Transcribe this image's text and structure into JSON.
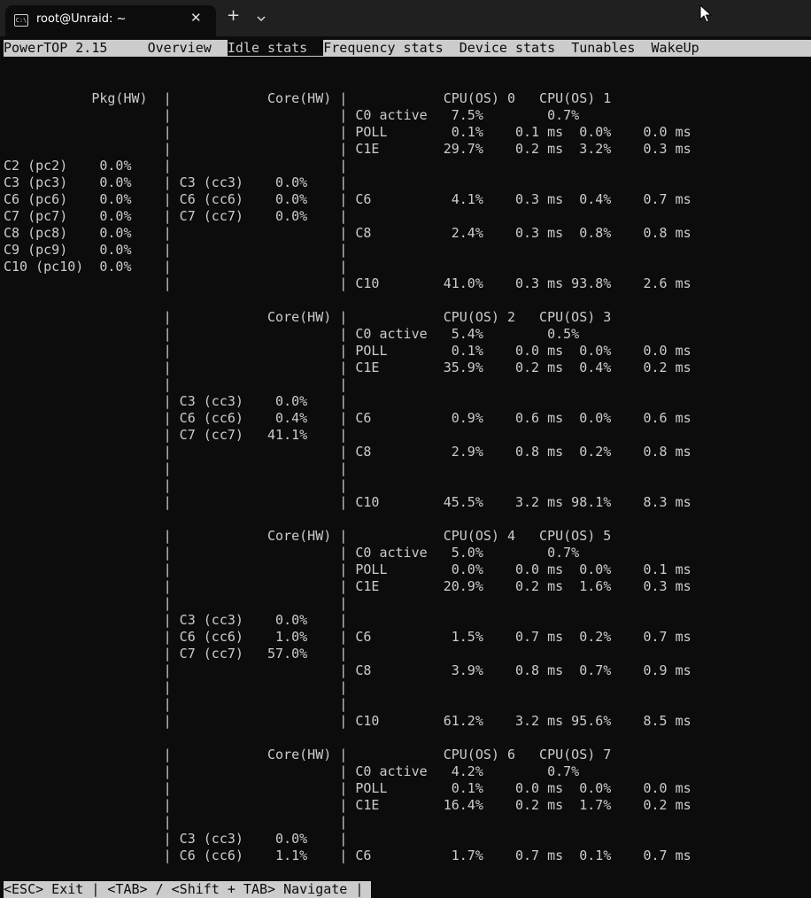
{
  "window": {
    "tab_title": "root@Unraid: ~",
    "tab_icon_text": "C:\\",
    "close_symbol": "✕",
    "new_tab_symbol": "+"
  },
  "powertop": {
    "version_label": "PowerTOP 2.15",
    "tabs": [
      {
        "label": "Overview",
        "active": false
      },
      {
        "label": "Idle stats",
        "active": true
      },
      {
        "label": "Frequency stats",
        "active": false
      },
      {
        "label": "Device stats",
        "active": false
      },
      {
        "label": "Tunables",
        "active": false
      },
      {
        "label": "WakeUp",
        "active": false
      }
    ],
    "screen_lines": [
      "",
      "",
      "           Pkg(HW)  |            Core(HW) |            CPU(OS) 0   CPU(OS) 1",
      "                    |                     | C0 active   7.5%        0.7%",
      "                    |                     | POLL        0.1%    0.1 ms  0.0%    0.0 ms",
      "                    |                     | C1E        29.7%    0.2 ms  3.2%    0.3 ms",
      "C2 (pc2)    0.0%    |                     |",
      "C3 (pc3)    0.0%    | C3 (cc3)    0.0%    |",
      "C6 (pc6)    0.0%    | C6 (cc6)    0.0%    | C6          4.1%    0.3 ms  0.4%    0.7 ms",
      "C7 (pc7)    0.0%    | C7 (cc7)    0.0%    |",
      "C8 (pc8)    0.0%    |                     | C8          2.4%    0.3 ms  0.8%    0.8 ms",
      "C9 (pc9)    0.0%    |                     |",
      "C10 (pc10)  0.0%    |                     |",
      "                    |                     | C10        41.0%    0.3 ms 93.8%    2.6 ms",
      "",
      "                    |            Core(HW) |            CPU(OS) 2   CPU(OS) 3",
      "                    |                     | C0 active   5.4%        0.5%",
      "                    |                     | POLL        0.1%    0.0 ms  0.0%    0.0 ms",
      "                    |                     | C1E        35.9%    0.2 ms  0.4%    0.2 ms",
      "                    |                     |",
      "                    | C3 (cc3)    0.0%    |",
      "                    | C6 (cc6)    0.4%    | C6          0.9%    0.6 ms  0.0%    0.6 ms",
      "                    | C7 (cc7)   41.1%    |",
      "                    |                     | C8          2.9%    0.8 ms  0.2%    0.8 ms",
      "                    |                     |",
      "                    |                     |",
      "                    |                     | C10        45.5%    3.2 ms 98.1%    8.3 ms",
      "",
      "                    |            Core(HW) |            CPU(OS) 4   CPU(OS) 5",
      "                    |                     | C0 active   5.0%        0.7%",
      "                    |                     | POLL        0.0%    0.0 ms  0.0%    0.1 ms",
      "                    |                     | C1E        20.9%    0.2 ms  1.6%    0.3 ms",
      "                    |                     |",
      "                    | C3 (cc3)    0.0%    |",
      "                    | C6 (cc6)    1.0%    | C6          1.5%    0.7 ms  0.2%    0.7 ms",
      "                    | C7 (cc7)   57.0%    |",
      "                    |                     | C8          3.9%    0.8 ms  0.7%    0.9 ms",
      "                    |                     |",
      "                    |                     |",
      "                    |                     | C10        61.2%    3.2 ms 95.6%    8.5 ms",
      "",
      "                    |            Core(HW) |            CPU(OS) 6   CPU(OS) 7",
      "                    |                     | C0 active   4.2%        0.7%",
      "                    |                     | POLL        0.1%    0.0 ms  0.0%    0.0 ms",
      "                    |                     | C1E        16.4%    0.2 ms  1.7%    0.2 ms",
      "                    |                     |",
      "                    | C3 (cc3)    0.0%    |",
      "                    | C6 (cc6)    1.1%    | C6          1.7%    0.7 ms  0.1%    0.7 ms",
      ""
    ],
    "status_bar": "<ESC> Exit | <TAB> / <Shift + TAB> Navigate | "
  },
  "colors": {
    "terminal_bg": "#0c0c0c",
    "terminal_fg": "#cccccc",
    "titlebar_bg": "#202020"
  }
}
